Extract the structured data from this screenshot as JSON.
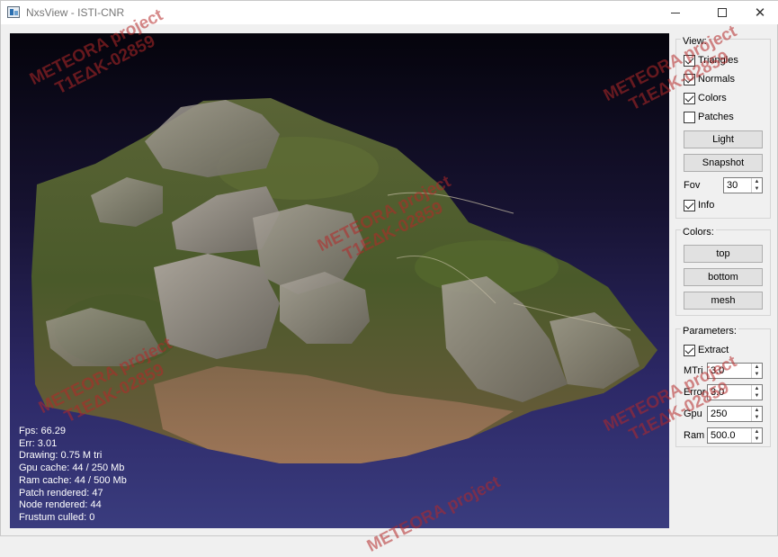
{
  "window": {
    "title": "NxsView - ISTI-CNR"
  },
  "stats": {
    "fps": "Fps: 66.29",
    "err": "Err: 3.01",
    "drawing": "Drawing: 0.75 M tri",
    "gpu_cache": "Gpu cache: 44 / 250 Mb",
    "ram_cache": "Ram cache: 44 / 500 Mb",
    "patch_rendered": "Patch rendered: 47",
    "node_rendered": "Node rendered: 44",
    "frustum_culled": "Frustum culled: 0"
  },
  "view": {
    "title": "View:",
    "triangles": "Triangles",
    "normals": "Normals",
    "colors": "Colors",
    "patches": "Patches",
    "light": "Light",
    "snapshot": "Snapshot",
    "fov_label": "Fov",
    "fov_value": "30",
    "info": "Info"
  },
  "colors": {
    "title": "Colors:",
    "top": "top",
    "bottom": "bottom",
    "mesh": "mesh"
  },
  "parameters": {
    "title": "Parameters:",
    "extract": "Extract",
    "mtri_label": "MTri",
    "mtri_value": "3.0",
    "error_label": "Error",
    "error_value": "3.0",
    "gpu_label": "Gpu",
    "gpu_value": "250",
    "ram_label": "Ram",
    "ram_value": "500.0"
  },
  "watermark": {
    "line1": "METEORA project",
    "line2": "T1EΔK-02859"
  },
  "colors_palette": {
    "background_top": "#05040c",
    "background_bottom": "#3a3c7e",
    "terrain_green": "#4d5a2c",
    "rock_gray": "#8a8478"
  }
}
